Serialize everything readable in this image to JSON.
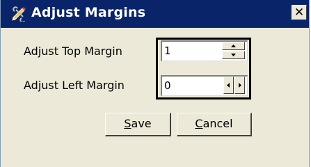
{
  "window": {
    "title": "Adjust Margins",
    "close_glyph": "✕"
  },
  "fields": {
    "top_margin": {
      "label": "Adjust Top Margin",
      "value": "1"
    },
    "left_margin": {
      "label": "Adjust Left Margin",
      "value": "0"
    }
  },
  "buttons": {
    "save": {
      "accel": "S",
      "rest": "ave"
    },
    "cancel": {
      "accel": "C",
      "rest": "ancel"
    }
  },
  "colors": {
    "titlebar": "#0a246a",
    "dialog_bg": "#ece9d8",
    "highlight_border": "#000000"
  },
  "icons": {
    "title": "pencil-wrench-icon",
    "spin_up": "arrow-up-icon",
    "spin_down": "arrow-down-icon",
    "spin_left": "arrow-left-icon",
    "spin_right": "arrow-right-icon"
  }
}
